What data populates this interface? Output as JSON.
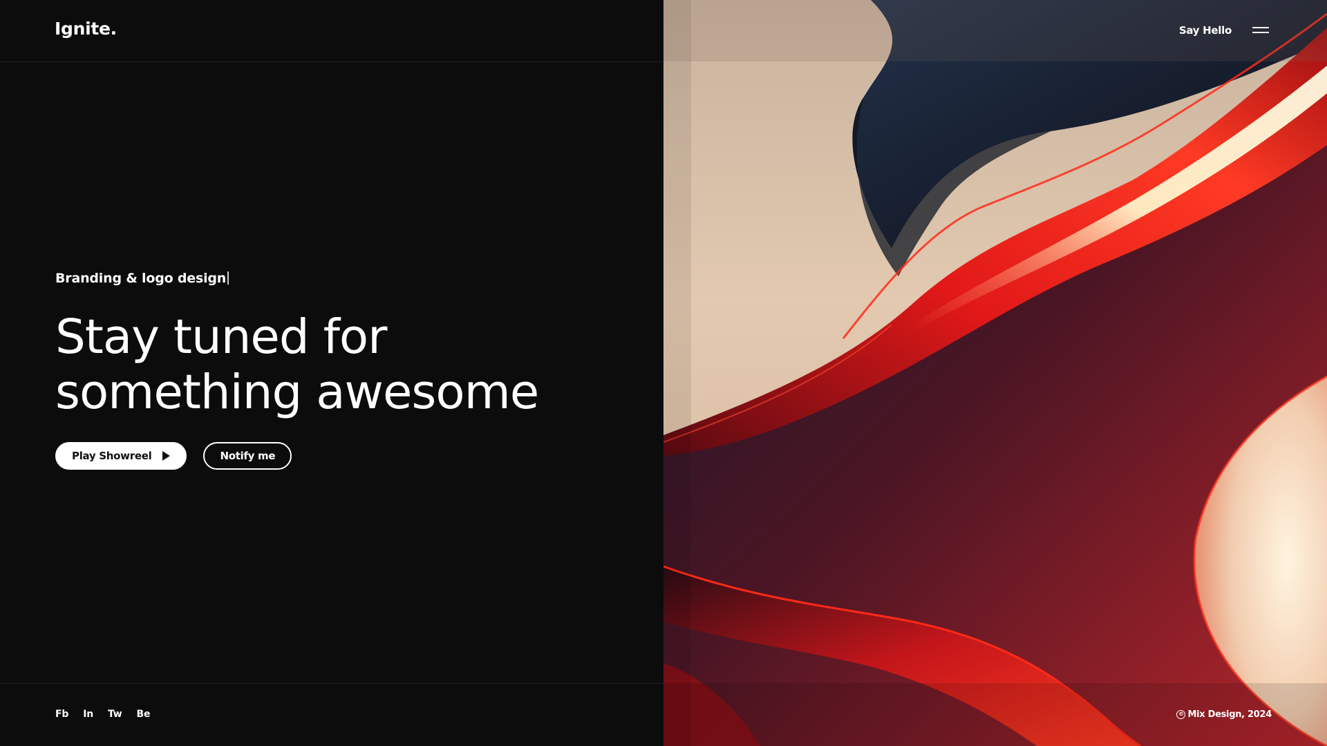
{
  "header": {
    "logo": "Ignite.",
    "say_hello": "Say Hello",
    "menu_icon": "hamburger-menu-icon"
  },
  "hero": {
    "subtitle": "Branding & logo design",
    "headline_line1": "Stay tuned for",
    "headline_line2": "something awesome",
    "primary_button": "Play Showreel",
    "primary_button_icon": "play-icon",
    "secondary_button": "Notify me"
  },
  "footer": {
    "socials": [
      "Fb",
      "In",
      "Tw",
      "Be"
    ],
    "copyright": "Mix Design, 2024",
    "copyright_icon": "©"
  },
  "colors": {
    "background": "#0c0c0c",
    "text": "#ffffff",
    "accent_red": "#e11a1a",
    "cream": "#dcc6af",
    "navy": "#1b2433"
  }
}
